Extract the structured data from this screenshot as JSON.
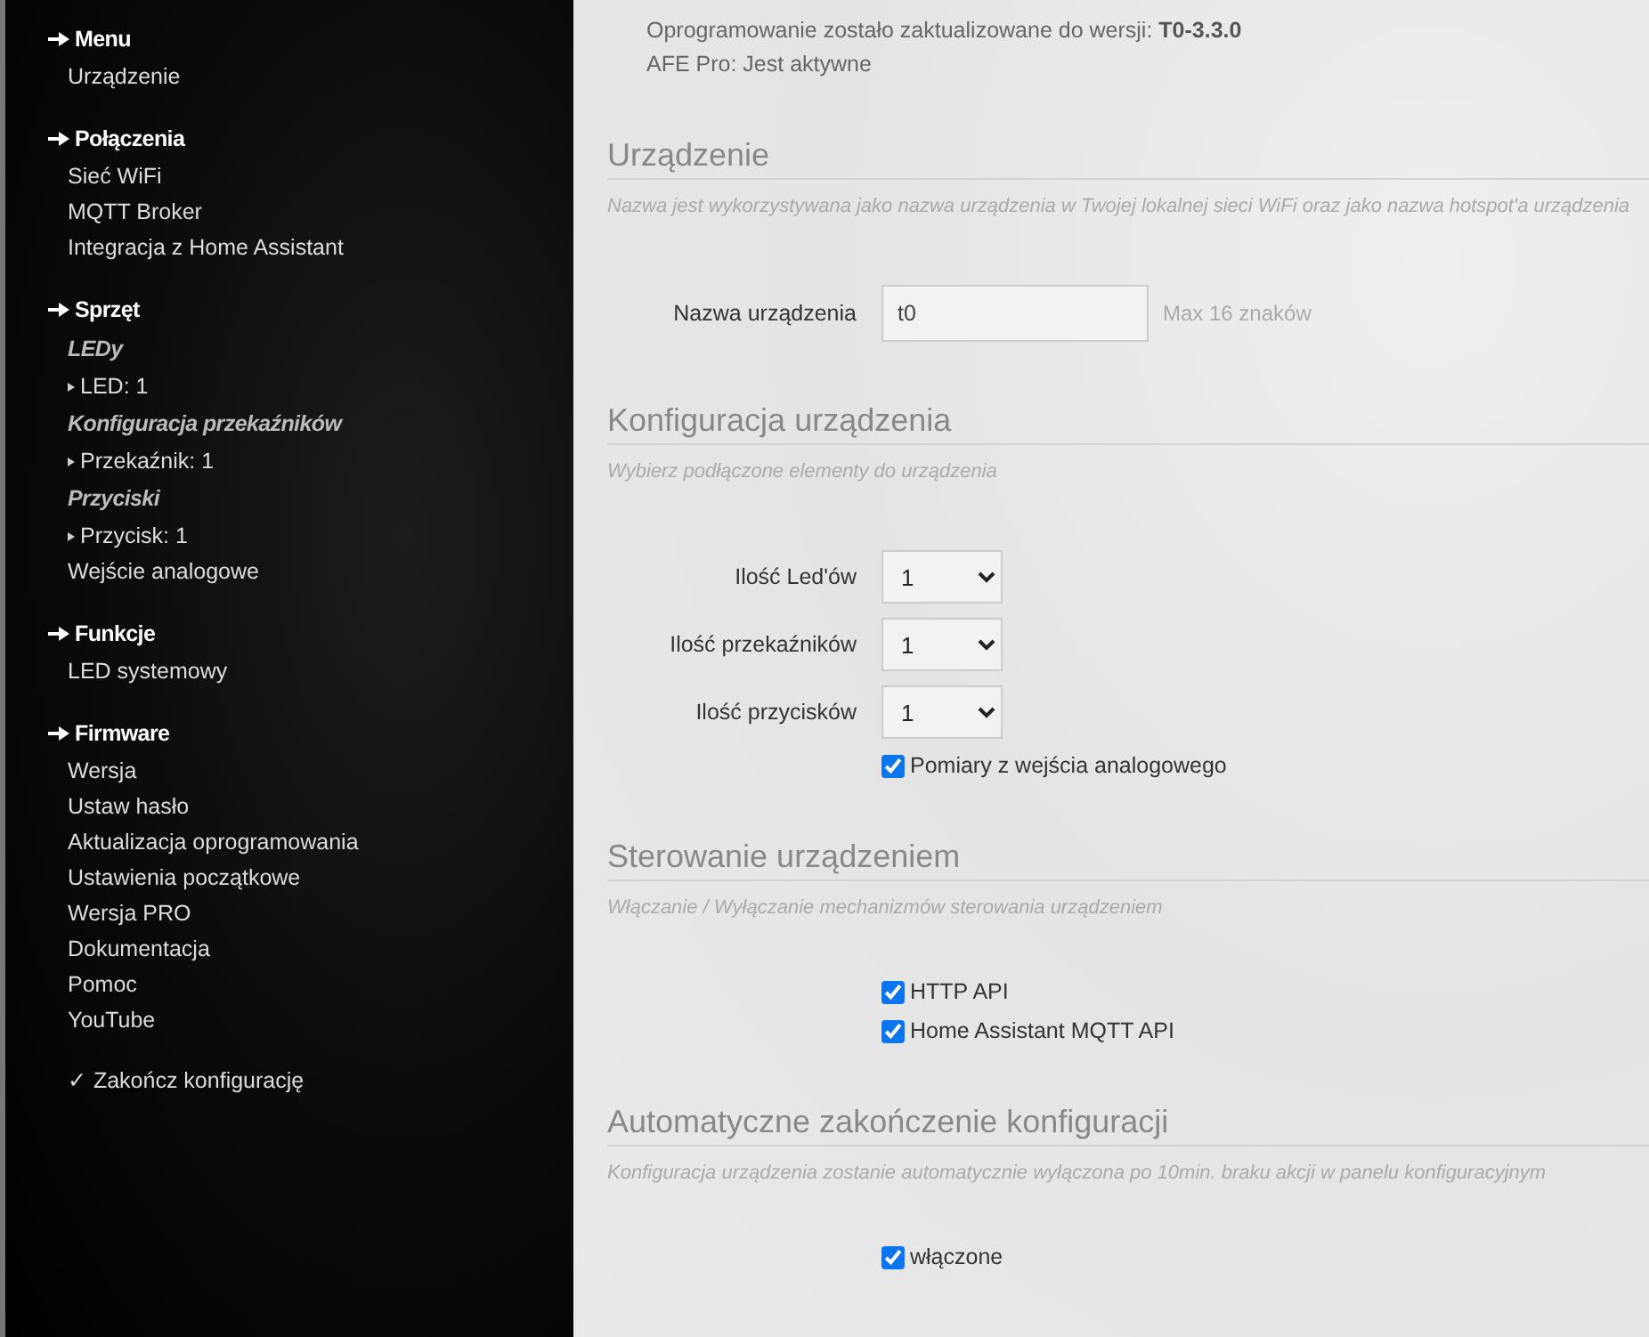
{
  "sidebar": {
    "sections": [
      {
        "title": "Menu",
        "items": [
          {
            "kind": "link",
            "label": "Urządzenie"
          }
        ]
      },
      {
        "title": "Połączenia",
        "items": [
          {
            "kind": "link",
            "label": "Sieć WiFi"
          },
          {
            "kind": "link",
            "label": "MQTT Broker"
          },
          {
            "kind": "link",
            "label": "Integracja z Home Assistant"
          }
        ]
      },
      {
        "title": "Sprzęt",
        "items": [
          {
            "kind": "group",
            "label": "LEDy"
          },
          {
            "kind": "sub",
            "label": "LED: 1"
          },
          {
            "kind": "group",
            "label": "Konfiguracja przekaźników"
          },
          {
            "kind": "sub",
            "label": "Przekaźnik: 1"
          },
          {
            "kind": "group",
            "label": "Przyciski"
          },
          {
            "kind": "sub",
            "label": "Przycisk: 1"
          },
          {
            "kind": "link",
            "label": "Wejście analogowe"
          }
        ]
      },
      {
        "title": "Funkcje",
        "items": [
          {
            "kind": "link",
            "label": "LED systemowy"
          }
        ]
      },
      {
        "title": "Firmware",
        "items": [
          {
            "kind": "link",
            "label": "Wersja"
          },
          {
            "kind": "link",
            "label": "Ustaw hasło"
          },
          {
            "kind": "link",
            "label": "Aktualizacja oprogramowania"
          },
          {
            "kind": "link",
            "label": "Ustawienia początkowe"
          },
          {
            "kind": "link",
            "label": "Wersja PRO"
          },
          {
            "kind": "link",
            "label": "Dokumentacja"
          },
          {
            "kind": "link",
            "label": "Pomoc"
          },
          {
            "kind": "link",
            "label": "YouTube"
          }
        ]
      }
    ],
    "finish": "✓ Zakończ konfigurację"
  },
  "notice": [
    "Oprogramowanie zostało zaktualizowane do wersji: **T0-3.3.0**",
    "AFE Pro: Jest aktywne"
  ],
  "sections": [
    {
      "title": "Urządzenie",
      "description": "Nazwa jest wykorzystywana jako nazwa urządzenia w Twojej lokalnej sieci WiFi oraz jako nazwa hotspot'a urządzenia",
      "fields": [
        {
          "kind": "text",
          "label": "Nazwa urządzenia",
          "value": "t0",
          "hint": "Max 16 znaków"
        }
      ]
    },
    {
      "title": "Konfiguracja urządzenia",
      "description": "Wybierz podłączone elementy do urządzenia",
      "fields": [
        {
          "kind": "select",
          "label": "Ilość Led'ów",
          "value": "1"
        },
        {
          "kind": "select",
          "label": "Ilość przekaźników",
          "value": "1"
        },
        {
          "kind": "select",
          "label": "Ilość przycisków",
          "value": "1"
        },
        {
          "kind": "checkbox",
          "label": "Pomiary z wejścia analogowego",
          "checked": true
        }
      ]
    },
    {
      "title": "Sterowanie urządzeniem",
      "description": "Włączanie / Wyłączanie mechanizmów sterowania urządzeniem",
      "fields": [
        {
          "kind": "checkbox",
          "label": "HTTP API",
          "checked": true
        },
        {
          "kind": "checkbox",
          "label": "Home Assistant MQTT API",
          "checked": true
        }
      ]
    },
    {
      "title": "Automatyczne zakończenie konfiguracji",
      "description": "Konfiguracja urządzenia zostanie automatycznie wyłączona po 10min. braku akcji w panelu konfiguracyjnym",
      "fields": [
        {
          "kind": "checkbox",
          "label": "włączone",
          "checked": true
        }
      ]
    }
  ]
}
